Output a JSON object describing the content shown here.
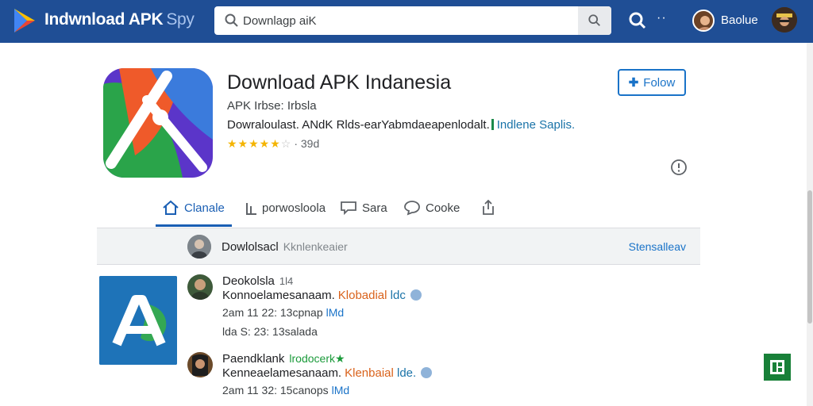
{
  "header": {
    "brand_primary": "Indwnload APK",
    "brand_secondary": "Spy",
    "search_value": "Downlagp aiK",
    "more_label": "··",
    "user_name": "Baolue"
  },
  "app": {
    "title": "Download APK Indanesia",
    "subtitle": "APK  Irbse: Irbsla",
    "description": "Dowraloulast. ANdK Rlds-earYabmdaeapenlodalt.",
    "description_tag": "Indlene Saplis.",
    "stars_filled": "★★★★★",
    "stars_empty": "☆",
    "rating_count": "· 39d",
    "rating_value_out_of_5": 4.5,
    "follow_label": "Folow"
  },
  "tabs": [
    {
      "label": "Clanale",
      "icon": "home-icon"
    },
    {
      "label": "porwosloola",
      "icon": "chart-icon"
    },
    {
      "label": "Sara",
      "icon": "comment-icon"
    },
    {
      "label": "Cooke",
      "icon": "chat-bubble-icon"
    },
    {
      "label": "",
      "icon": "share-icon"
    }
  ],
  "compose": {
    "name": "Dowlolsacl",
    "placeholder": "Kknlenkeaier",
    "action": "Stensalleav"
  },
  "comments": [
    {
      "name": "Deokolsla",
      "meta": "1l4",
      "badge": "",
      "text": "Konnoelamesanaam.",
      "highlight": "Klobadial",
      "highlight2": "ldc",
      "time1": "2am   11 22: 13cpnap",
      "time1_link": "lMd",
      "time2": "lda    S: 23: 13salada"
    },
    {
      "name": "Paendklank",
      "meta": "",
      "badge": "lrodocerk★",
      "text": "Kenneaelamesanaam.",
      "highlight": "Klenbaial",
      "highlight2": "lde.",
      "time1": "2am   11 32: 15canops",
      "time1_link": "lMd",
      "time2": ""
    }
  ],
  "colors": {
    "topbar": "#1f4e95",
    "accent": "#1a73c8",
    "star": "#f4b400"
  }
}
